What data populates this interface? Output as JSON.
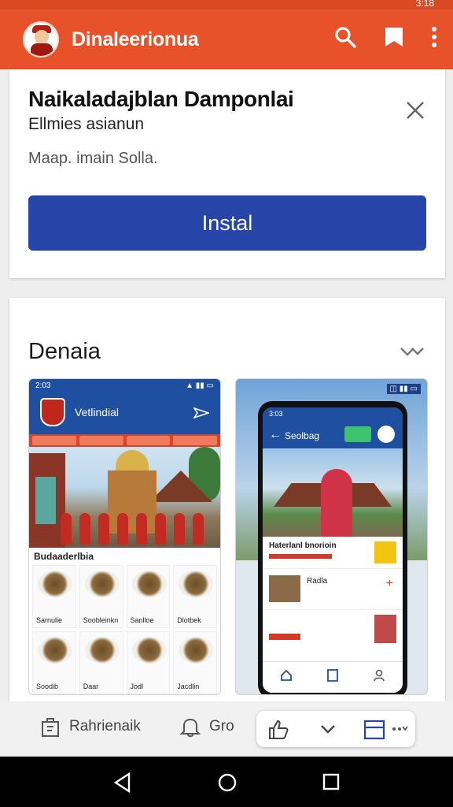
{
  "status_bar": {
    "time": "3:18"
  },
  "app_bar": {
    "title": "Dinaleerionua",
    "icons": [
      "app-logo",
      "search-icon",
      "bookmark-icon",
      "more-vert-icon"
    ],
    "color": "#e8522a"
  },
  "install_card": {
    "app_name": "Naikaladajblan Damponlai",
    "subtitle": "Ellmies asianun",
    "meta": "Maap. imain Solla.",
    "install_label": "Instal",
    "button_color": "#2744a8"
  },
  "gallery": {
    "title": "Denaia",
    "shot1": {
      "status_time": "2:03",
      "header_title": "Vetlindial",
      "food_section": "Budaaderlbia",
      "food_labels": [
        "Sarnulie",
        "Soobleinkn",
        "Sanlloe",
        "Dlotbek",
        "Soodib",
        "Daar",
        "Jodl",
        "Jacdlin"
      ]
    },
    "shot2": {
      "status_time": "3:03",
      "screen_title": "Seolbag",
      "card_title": "Haterlanl bnorioin",
      "row_title": "Radla"
    }
  },
  "actions": {
    "share_label": "Rahrienaik",
    "notify_label": "Gro"
  },
  "system_nav": [
    "back-icon",
    "home-icon",
    "recents-icon"
  ]
}
